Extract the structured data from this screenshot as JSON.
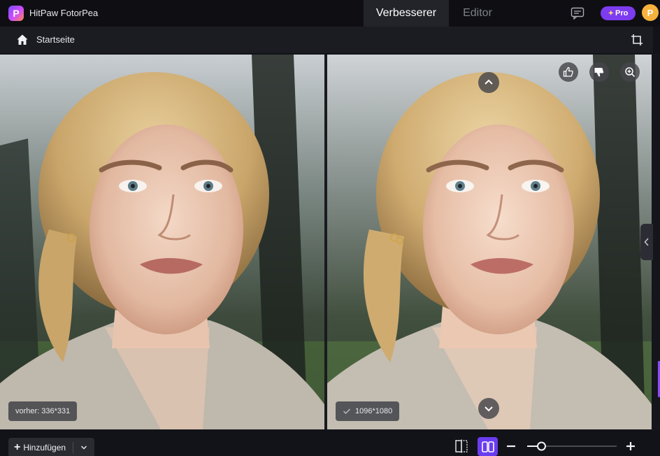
{
  "app": {
    "title": "HitPaw FotorPea",
    "logo_letter": "P"
  },
  "tabs": [
    {
      "label": "Verbesserer",
      "active": true
    },
    {
      "label": "Editor",
      "active": false
    }
  ],
  "header": {
    "pro_label": "Pro",
    "avatar_letter": "P"
  },
  "subbar": {
    "home_label": "Startseite"
  },
  "panes": {
    "before_label": "vorher: 336*331",
    "after_label": "1096*1080"
  },
  "bottombar": {
    "add_label": "Hinzufügen",
    "zoom_fraction": 0.16
  },
  "colors": {
    "accent": "#7d3cf0",
    "background": "#121318"
  }
}
